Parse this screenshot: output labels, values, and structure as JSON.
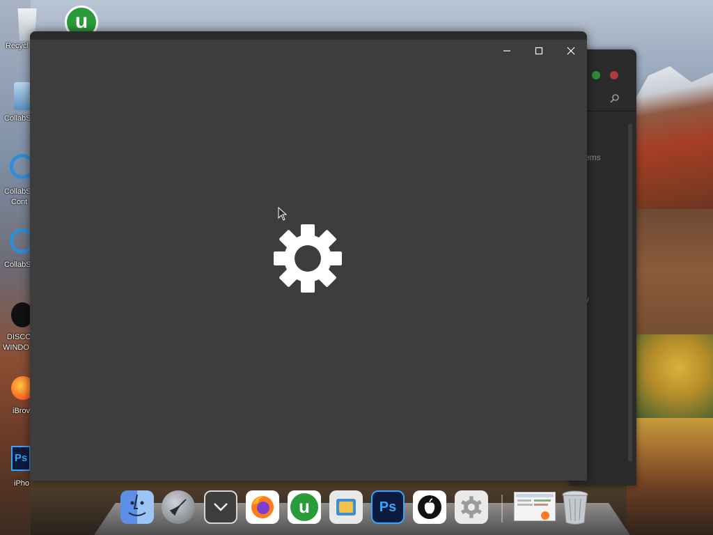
{
  "desktop": {
    "icons": [
      {
        "label": "Recycl",
        "icon": "recycle-bin-icon"
      },
      {
        "label": "CollabS",
        "icon": "collab-icon"
      },
      {
        "label": "CollabS",
        "label2": "Cont",
        "icon": "internet-explorer-icon"
      },
      {
        "label": "CollabS",
        "icon": "internet-explorer-icon"
      },
      {
        "label": "DISCO",
        "label2": "WINDO",
        "icon": "disco-icon"
      },
      {
        "label": "iBrov",
        "icon": "firefox-icon"
      },
      {
        "label": "iPho",
        "icon": "photoshop-icon"
      }
    ],
    "utorrent_letter": "u"
  },
  "background_window": {
    "text1": "ems",
    "text2": "y"
  },
  "main_window": {
    "loading_icon": "gear-icon",
    "controls": [
      "minimize",
      "maximize",
      "close"
    ]
  },
  "dock": {
    "items": [
      {
        "name": "finder"
      },
      {
        "name": "launchpad"
      },
      {
        "name": "downloads"
      },
      {
        "name": "firefox"
      },
      {
        "name": "utorrent",
        "letter": "u"
      },
      {
        "name": "app-mesh"
      },
      {
        "name": "photoshop",
        "letter": "Ps"
      },
      {
        "name": "apple"
      },
      {
        "name": "system-preferences"
      },
      {
        "name": "window-thumbnail"
      },
      {
        "name": "trash"
      }
    ]
  },
  "colors": {
    "window_bg": "#3d3d3d",
    "titlebar": "#2b2b2b",
    "gear": "#ffffff",
    "utorrent_green": "#2a9b3a"
  }
}
